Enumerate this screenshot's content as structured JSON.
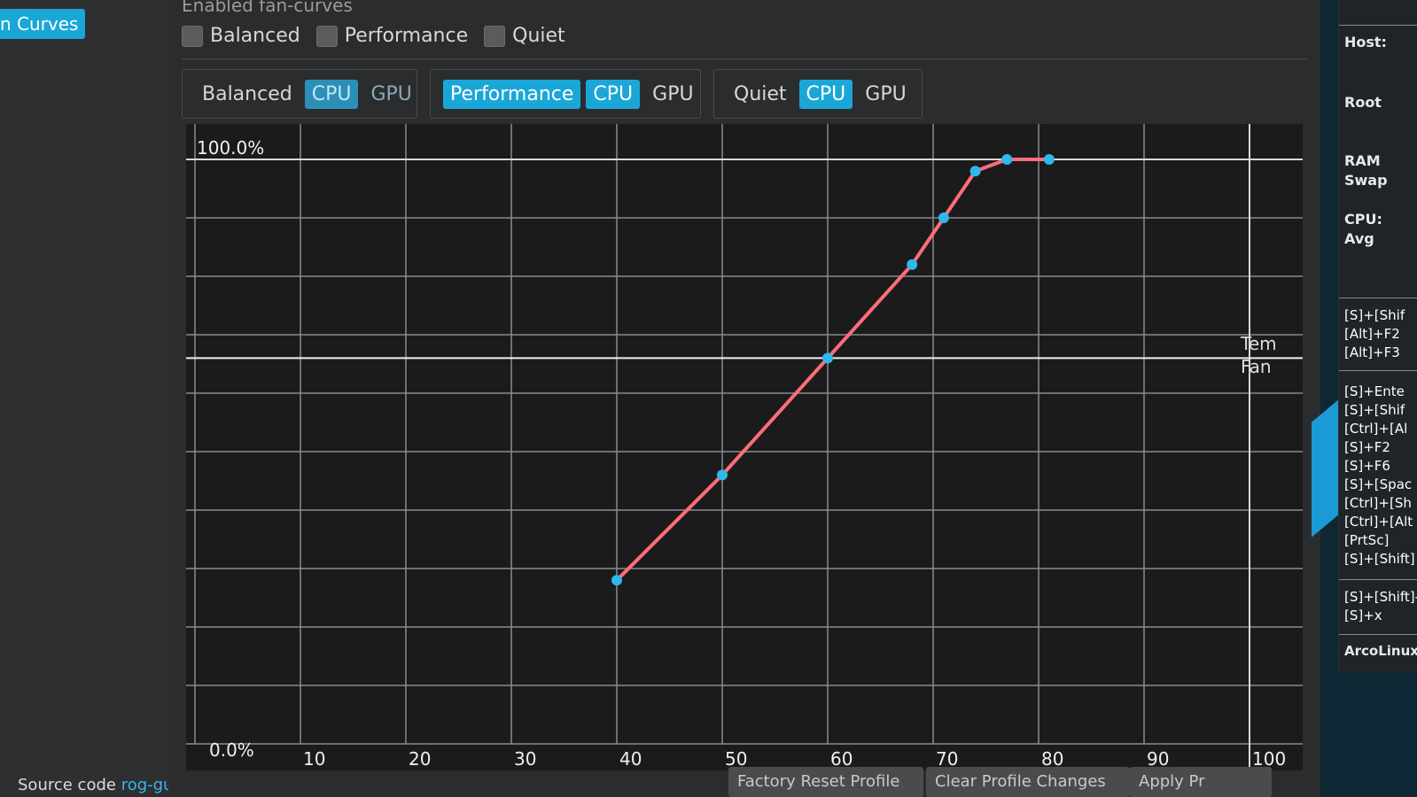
{
  "nav": {
    "active_item": "n Curves"
  },
  "source": {
    "prefix": "Source code",
    "link": "rog-gui."
  },
  "enabled": {
    "title": "Enabled fan-curves",
    "options": [
      {
        "label": "Balanced",
        "checked": false
      },
      {
        "label": "Performance",
        "checked": false
      },
      {
        "label": "Quiet",
        "checked": false
      }
    ]
  },
  "profiles": [
    {
      "label": "Balanced",
      "cpu": "CPU",
      "gpu": "GPU",
      "active": false,
      "selected": "CPU"
    },
    {
      "label": "Performance",
      "cpu": "CPU",
      "gpu": "GPU",
      "active": true,
      "selected": "CPU"
    },
    {
      "label": "Quiet",
      "cpu": "CPU",
      "gpu": "GPU",
      "active": false,
      "selected": "CPU"
    }
  ],
  "legend": {
    "line1": "Tem",
    "line2": "Fan"
  },
  "chart_data": {
    "type": "line",
    "x_ticks": [
      "10",
      "20",
      "30",
      "40",
      "50",
      "60",
      "70",
      "80",
      "90",
      "100"
    ],
    "y_top_label": "100.0%",
    "y_bottom_label": "0.0%",
    "xlim": [
      0,
      100
    ],
    "ylim": [
      0,
      100
    ],
    "grid": true,
    "series": [
      {
        "points": [
          [
            40,
            28
          ],
          [
            50,
            46
          ],
          [
            60,
            66
          ],
          [
            68,
            82
          ],
          [
            71,
            90
          ],
          [
            74,
            98
          ],
          [
            77,
            100
          ],
          [
            81,
            100
          ]
        ],
        "line_color": "#ff6d7a",
        "point_color": "#2fb8ea"
      }
    ],
    "crosshair": {
      "y": 66
    }
  },
  "buttons": {
    "factory_reset": "Factory Reset Profile",
    "clear_profile": "Clear Profile Changes",
    "apply": "Apply Pr"
  },
  "right_panel": {
    "host": "Host:",
    "root": "Root",
    "ram": "RAM",
    "swap": "Swap",
    "cpu": "CPU:",
    "avg": "Avg",
    "shortcuts_1": [
      "[S]+[Shif",
      "[Alt]+F2",
      "[Alt]+F3"
    ],
    "shortcuts_2": [
      "[S]+Ente",
      "[S]+[Shif",
      "[Ctrl]+[Al",
      "[S]+F2",
      "[S]+F6",
      "[S]+[Spac",
      "[Ctrl]+[Sh",
      "[Ctrl]+[Alt",
      "[PrtSc]",
      "[S]+[Shift]"
    ],
    "shortcuts_3": [
      "[S]+[Shift]-",
      "[S]+x"
    ],
    "footer": "ArcoLinux"
  }
}
